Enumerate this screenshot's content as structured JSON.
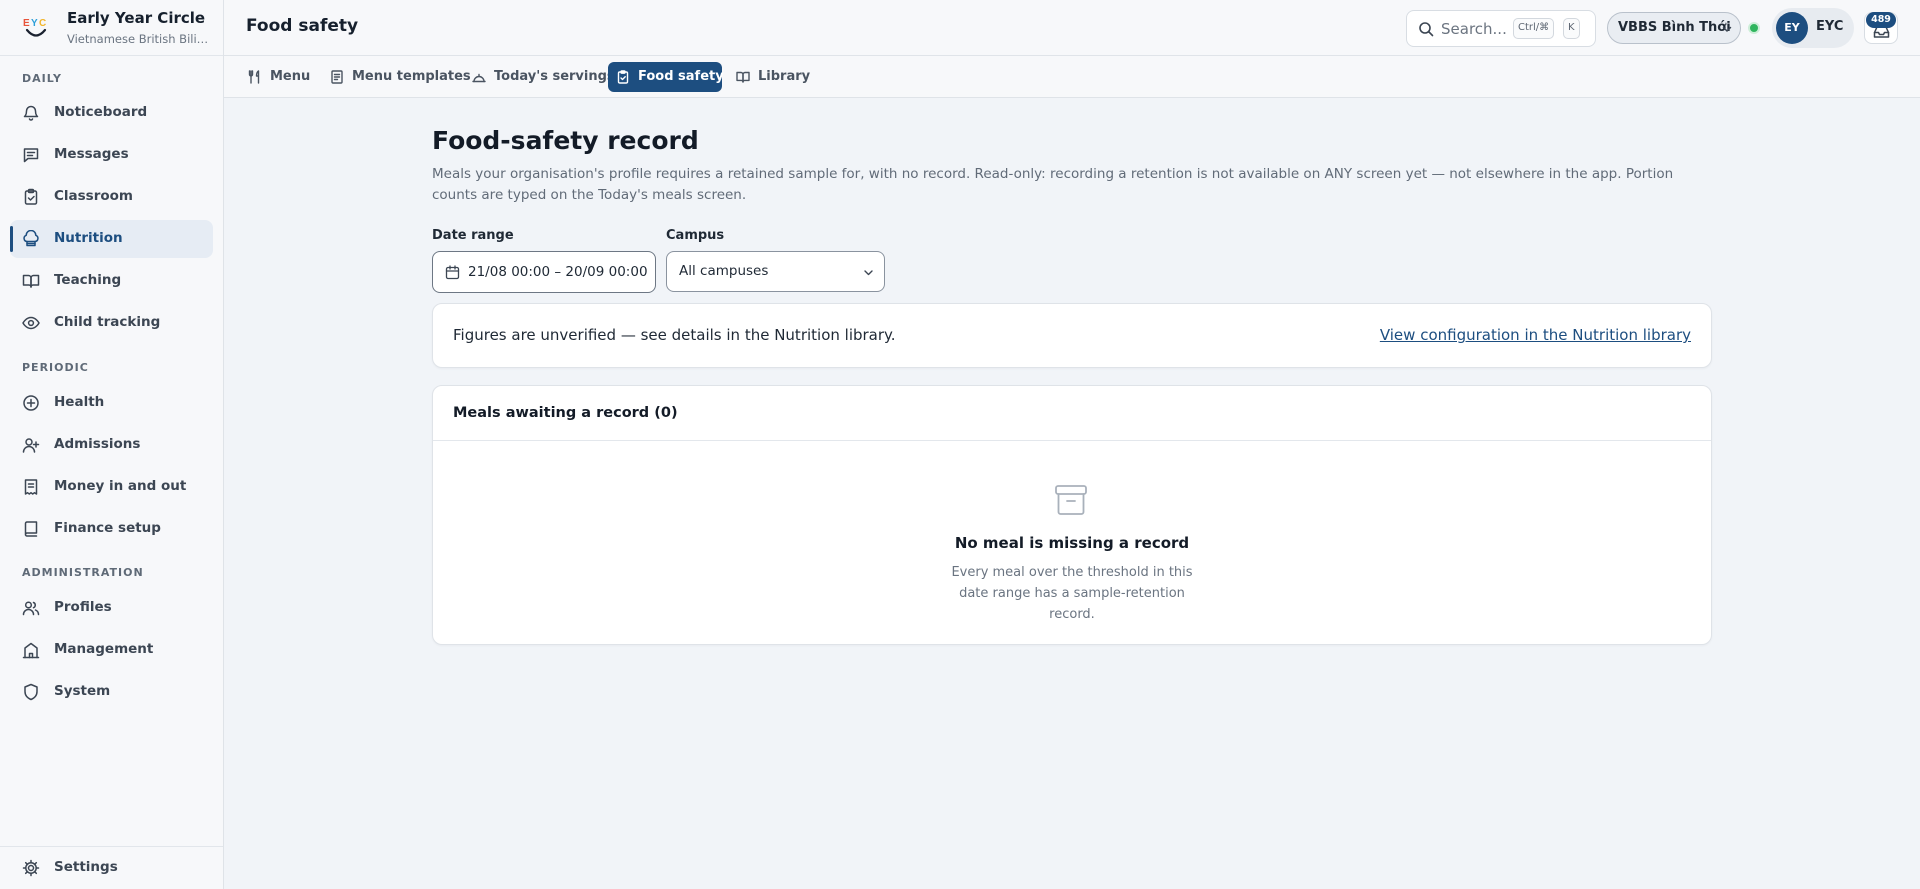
{
  "brand": {
    "name": "Early Year Circle",
    "subtitle": "Vietnamese British Bilingual School",
    "logo_text": "EYC"
  },
  "sidebar": {
    "sections": {
      "daily": "DAILY",
      "periodic": "PERIODIC",
      "administration": "ADMINISTRATION"
    },
    "items": [
      {
        "label": "Noticeboard",
        "icon": "bell-icon"
      },
      {
        "label": "Messages",
        "icon": "message-icon"
      },
      {
        "label": "Classroom",
        "icon": "clipboard-icon"
      },
      {
        "label": "Nutrition",
        "icon": "chef-hat-icon",
        "active": true
      },
      {
        "label": "Teaching",
        "icon": "book-open-icon"
      },
      {
        "label": "Child tracking",
        "icon": "eye-icon"
      },
      {
        "label": "Health",
        "icon": "plus-circle-icon"
      },
      {
        "label": "Admissions",
        "icon": "user-plus-icon"
      },
      {
        "label": "Money in and out",
        "icon": "receipt-icon"
      },
      {
        "label": "Finance setup",
        "icon": "book-icon"
      },
      {
        "label": "Profiles",
        "icon": "users-icon"
      },
      {
        "label": "Management",
        "icon": "building-icon"
      },
      {
        "label": "System",
        "icon": "shield-icon"
      }
    ],
    "settings_label": "Settings"
  },
  "header": {
    "title": "Food safety",
    "search_placeholder": "Search...",
    "shortcut_mod": "Ctrl/⌘",
    "shortcut_key": "K",
    "campus": "VBBS Bình Thới",
    "user_initials": "EY",
    "user_name": "EYC",
    "notification_count": "489"
  },
  "tabs": [
    {
      "label": "Menu",
      "icon": "utensils-icon"
    },
    {
      "label": "Menu templates",
      "icon": "document-icon"
    },
    {
      "label": "Today's servings",
      "icon": "serving-icon"
    },
    {
      "label": "Food safety",
      "icon": "clipboard-check-icon",
      "active": true
    },
    {
      "label": "Library",
      "icon": "book-open-icon"
    }
  ],
  "main": {
    "title": "Food-safety record",
    "description": "Meals your organisation's profile requires a retained sample for, with no record. Read-only: recording a retention is not available on ANY screen yet — not elsewhere in the app. Portion counts are typed on the Today's meals screen.",
    "date_range_label": "Date range",
    "date_range_value": "21/08 00:00 – 20/09 00:00",
    "campus_label": "Campus",
    "campus_value": "All campuses",
    "notice_text": "Figures are unverified — see details in the Nutrition library.",
    "notice_link": "View configuration in the Nutrition library",
    "list_title": "Meals awaiting a record (0)",
    "empty_title": "No meal is missing a record",
    "empty_text": "Every meal over the threshold in this date range has a sample-retention record."
  },
  "colors": {
    "accent": "#1d4e80",
    "status_online": "#2fb55d",
    "background": "#f1f4f8"
  }
}
